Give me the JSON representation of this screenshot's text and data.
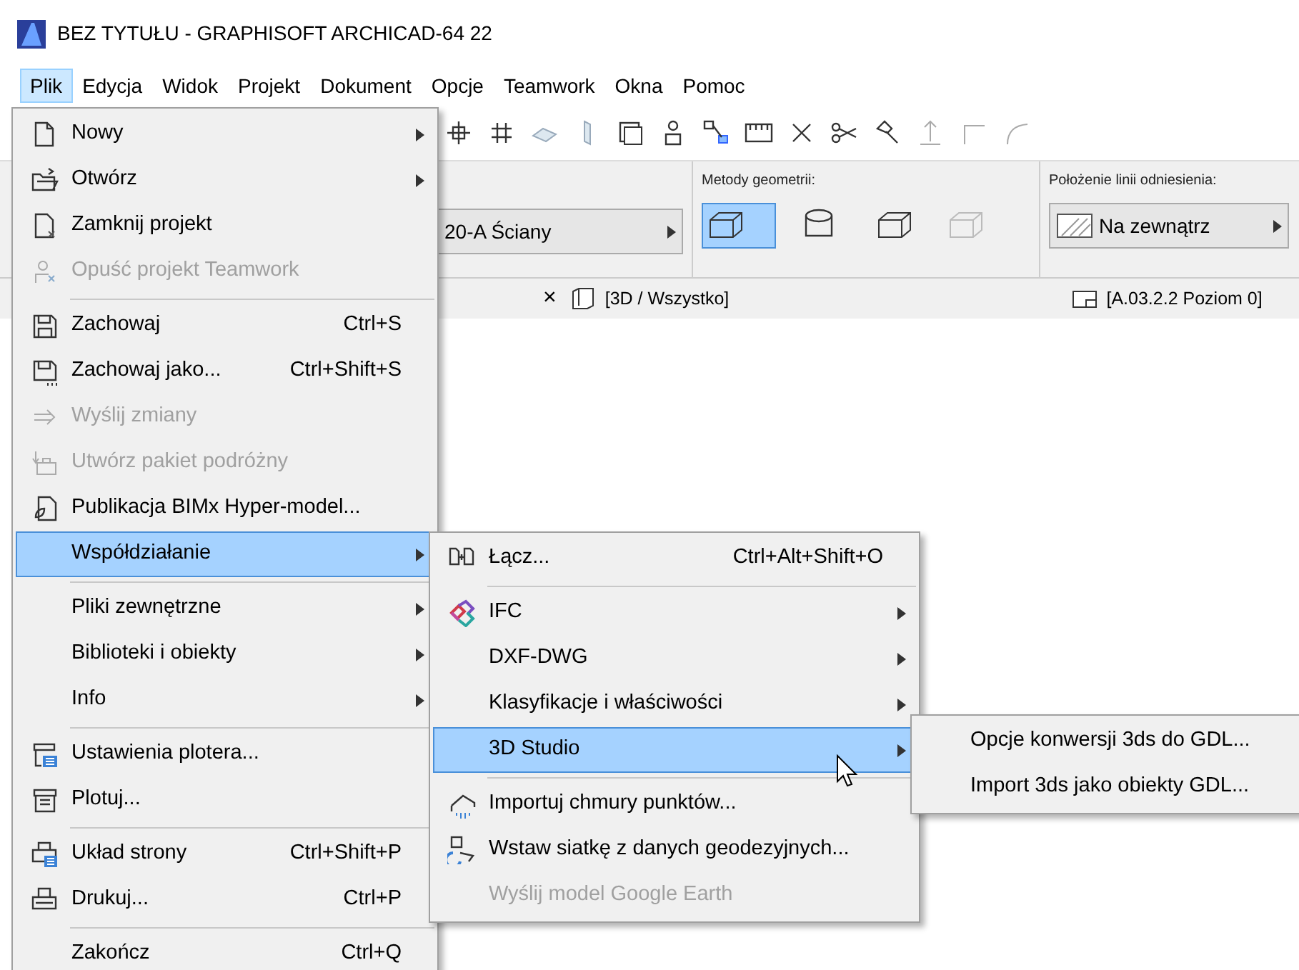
{
  "window": {
    "title": "BEZ TYTUŁU - GRAPHISOFT ARCHICAD-64 22"
  },
  "menubar": [
    {
      "label": "Plik",
      "selected": true
    },
    {
      "label": "Edycja",
      "selected": false
    },
    {
      "label": "Widok",
      "selected": false
    },
    {
      "label": "Projekt",
      "selected": false
    },
    {
      "label": "Dokument",
      "selected": false
    },
    {
      "label": "Opcje",
      "selected": false
    },
    {
      "label": "Teamwork",
      "selected": false
    },
    {
      "label": "Okna",
      "selected": false
    },
    {
      "label": "Pomoc",
      "selected": false
    }
  ],
  "info_box": {
    "element_dropdown": {
      "value": "20-A Ściany"
    },
    "geometry_method": {
      "label": "Metody geometrii:"
    },
    "reference_line": {
      "label": "Położenie linii odniesienia:",
      "value": "Na zewnątrz"
    }
  },
  "tab_bar": {
    "close_glyph": "×",
    "tabs": [
      {
        "label": "[3D / Wszystko]"
      },
      {
        "label": "[A.03.2.2 Poziom 0]"
      }
    ]
  },
  "file_menu": [
    {
      "kind": "item",
      "label": "Nowy",
      "submenu": true,
      "disabled": false,
      "selected": false
    },
    {
      "kind": "item",
      "label": "Otwórz",
      "submenu": true,
      "disabled": false,
      "selected": false
    },
    {
      "kind": "item",
      "label": "Zamknij projekt",
      "submenu": false,
      "disabled": false,
      "selected": false
    },
    {
      "kind": "item",
      "label": "Opuść projekt Teamwork",
      "submenu": false,
      "disabled": true,
      "selected": false
    },
    {
      "kind": "separator"
    },
    {
      "kind": "item",
      "label": "Zachowaj",
      "shortcut": "Ctrl+S",
      "submenu": false,
      "disabled": false,
      "selected": false
    },
    {
      "kind": "item",
      "label": "Zachowaj jako...",
      "shortcut": "Ctrl+Shift+S",
      "submenu": false,
      "disabled": false,
      "selected": false
    },
    {
      "kind": "item",
      "label": "Wyślij zmiany",
      "submenu": false,
      "disabled": true,
      "selected": false
    },
    {
      "kind": "item",
      "label": "Utwórz pakiet podróżny",
      "submenu": false,
      "disabled": true,
      "selected": false
    },
    {
      "kind": "item",
      "label": "Publikacja BIMx Hyper-model...",
      "submenu": false,
      "disabled": false,
      "selected": false
    },
    {
      "kind": "item",
      "label": "Współdziałanie",
      "submenu": true,
      "disabled": false,
      "selected": true
    },
    {
      "kind": "separator"
    },
    {
      "kind": "item",
      "label": "Pliki zewnętrzne",
      "submenu": true,
      "disabled": false,
      "selected": false
    },
    {
      "kind": "item",
      "label": "Biblioteki i obiekty",
      "submenu": true,
      "disabled": false,
      "selected": false
    },
    {
      "kind": "item",
      "label": "Info",
      "submenu": true,
      "disabled": false,
      "selected": false
    },
    {
      "kind": "separator"
    },
    {
      "kind": "item",
      "label": "Ustawienia plotera...",
      "submenu": false,
      "disabled": false,
      "selected": false
    },
    {
      "kind": "item",
      "label": "Plotuj...",
      "submenu": false,
      "disabled": false,
      "selected": false
    },
    {
      "kind": "separator"
    },
    {
      "kind": "item",
      "label": "Układ strony",
      "shortcut": "Ctrl+Shift+P",
      "submenu": false,
      "disabled": false,
      "selected": false
    },
    {
      "kind": "item",
      "label": "Drukuj...",
      "shortcut": "Ctrl+P",
      "submenu": false,
      "disabled": false,
      "selected": false
    },
    {
      "kind": "separator"
    },
    {
      "kind": "item",
      "label": "Zakończ",
      "shortcut": "Ctrl+Q",
      "submenu": false,
      "disabled": false,
      "selected": false
    }
  ],
  "interop_submenu": [
    {
      "kind": "item",
      "label": "Łącz...",
      "shortcut": "Ctrl+Alt+Shift+O",
      "submenu": false,
      "disabled": false,
      "selected": false
    },
    {
      "kind": "separator"
    },
    {
      "kind": "item",
      "label": "IFC",
      "submenu": true,
      "disabled": false,
      "selected": false
    },
    {
      "kind": "item",
      "label": "DXF-DWG",
      "submenu": true,
      "disabled": false,
      "selected": false
    },
    {
      "kind": "item",
      "label": "Klasyfikacje i właściwości",
      "submenu": true,
      "disabled": false,
      "selected": false
    },
    {
      "kind": "item",
      "label": "3D Studio",
      "submenu": true,
      "disabled": false,
      "selected": true
    },
    {
      "kind": "separator"
    },
    {
      "kind": "item",
      "label": "Importuj chmury punktów...",
      "submenu": false,
      "disabled": false,
      "selected": false
    },
    {
      "kind": "item",
      "label": "Wstaw siatkę z danych geodezyjnych...",
      "submenu": false,
      "disabled": false,
      "selected": false
    },
    {
      "kind": "item",
      "label": "Wyślij model Google Earth",
      "submenu": false,
      "disabled": true,
      "selected": false
    }
  ],
  "studio_submenu": [
    {
      "kind": "item",
      "label": "Opcje konwersji 3ds do GDL...",
      "submenu": false,
      "disabled": false,
      "selected": false
    },
    {
      "kind": "item",
      "label": "Import 3ds jako obiekty GDL...",
      "submenu": false,
      "disabled": false,
      "selected": false
    }
  ]
}
